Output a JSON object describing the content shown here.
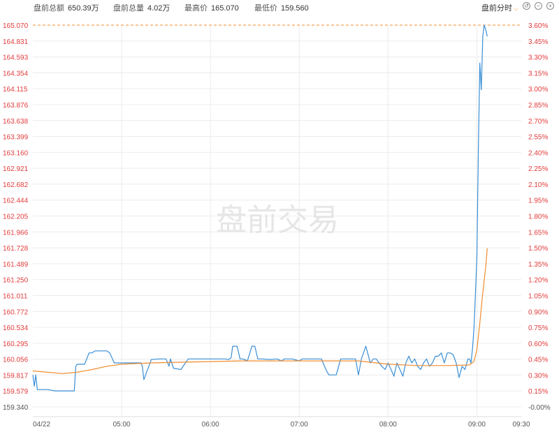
{
  "header": {
    "stats": [
      {
        "label": "盘前总额",
        "value": "650.39万"
      },
      {
        "label": "盘前总量",
        "value": "4.02万"
      },
      {
        "label": "最高价",
        "value": "165.070"
      },
      {
        "label": "最低价",
        "value": "159.560"
      }
    ],
    "mode_label": "盘前分时",
    "tool_icons": [
      "reset-icon",
      "zoom-out-icon",
      "zoom-in-icon"
    ]
  },
  "chart_data": {
    "type": "line",
    "watermark": "盘前交易",
    "date_label": "04/22",
    "x_ticks": [
      "05:00",
      "06:00",
      "07:00",
      "08:00",
      "09:00",
      "09:30"
    ],
    "x_range": [
      "04:00",
      "09:30"
    ],
    "y_left_ticks": [
      "165.070",
      "164.831",
      "164.593",
      "164.354",
      "164.115",
      "163.876",
      "163.638",
      "163.399",
      "163.160",
      "162.921",
      "162.682",
      "162.444",
      "162.205",
      "161.966",
      "161.728",
      "161.489",
      "161.250",
      "161.011",
      "160.772",
      "160.534",
      "160.295",
      "160.056",
      "159.817",
      "159.579",
      "159.340"
    ],
    "y_right_ticks": [
      "3.60%",
      "3.45%",
      "3.30%",
      "3.15%",
      "3.00%",
      "2.85%",
      "2.70%",
      "2.55%",
      "2.40%",
      "2.25%",
      "2.10%",
      "1.95%",
      "1.80%",
      "1.65%",
      "1.50%",
      "1.35%",
      "1.20%",
      "1.05%",
      "0.90%",
      "0.75%",
      "0.60%",
      "0.45%",
      "0.30%",
      "0.15%",
      "-0.00%"
    ],
    "ylim": [
      159.34,
      165.07
    ],
    "reference_high": 165.07,
    "colors": {
      "price": "#3a8fd6",
      "average": "#f08c2e",
      "left_axis": "#e23b3b",
      "right_axis": "#e23b3b",
      "grid": "#ececec",
      "high_line": "#f08c2e"
    },
    "series": [
      {
        "name": "price",
        "x": [
          "04:00",
          "04:01",
          "04:02",
          "04:03",
          "04:05",
          "04:10",
          "04:15",
          "04:20",
          "04:25",
          "04:28",
          "04:29",
          "04:30",
          "04:35",
          "04:38",
          "04:40",
          "04:42",
          "04:45",
          "04:50",
          "04:52",
          "04:55",
          "05:00",
          "05:05",
          "05:10",
          "05:12",
          "05:13",
          "05:14",
          "05:15",
          "05:20",
          "05:25",
          "05:30",
          "05:32",
          "05:33",
          "05:35",
          "05:40",
          "05:45",
          "05:50",
          "05:55",
          "06:00",
          "06:05",
          "06:10",
          "06:12",
          "06:13",
          "06:14",
          "06:15",
          "06:18",
          "06:20",
          "06:22",
          "06:25",
          "06:28",
          "06:30",
          "06:32",
          "06:35",
          "06:40",
          "06:45",
          "06:48",
          "06:50",
          "06:52",
          "06:55",
          "07:00",
          "07:02",
          "07:05",
          "07:08",
          "07:10",
          "07:12",
          "07:15",
          "07:18",
          "07:20",
          "07:22",
          "07:25",
          "07:28",
          "07:30",
          "07:32",
          "07:35",
          "07:38",
          "07:40",
          "07:42",
          "07:45",
          "07:48",
          "07:50",
          "07:52",
          "07:55",
          "07:58",
          "08:00",
          "08:02",
          "08:04",
          "08:06",
          "08:08",
          "08:10",
          "08:12",
          "08:14",
          "08:16",
          "08:18",
          "08:20",
          "08:22",
          "08:24",
          "08:26",
          "08:28",
          "08:30",
          "08:32",
          "08:34",
          "08:36",
          "08:38",
          "08:40",
          "08:42",
          "08:44",
          "08:46",
          "08:48",
          "08:50",
          "08:52",
          "08:54",
          "08:55",
          "08:56",
          "08:57",
          "08:58",
          "08:59",
          "09:00",
          "09:01",
          "09:02",
          "09:03",
          "09:04",
          "09:05",
          "09:06",
          "09:07"
        ],
        "values": [
          159.82,
          159.65,
          159.82,
          159.6,
          159.6,
          159.6,
          159.58,
          159.58,
          159.58,
          159.58,
          159.95,
          159.98,
          159.98,
          160.15,
          160.15,
          160.18,
          160.18,
          160.18,
          160.15,
          160.0,
          160.0,
          160.0,
          160.0,
          160.0,
          160.0,
          159.95,
          159.75,
          160.05,
          160.06,
          160.06,
          159.95,
          160.06,
          159.92,
          159.9,
          160.06,
          160.06,
          160.06,
          160.06,
          160.06,
          160.06,
          160.05,
          160.06,
          160.08,
          160.25,
          160.25,
          160.06,
          160.06,
          160.03,
          160.25,
          160.25,
          160.06,
          160.06,
          160.05,
          160.06,
          160.03,
          160.06,
          160.06,
          160.06,
          160.03,
          160.06,
          160.06,
          160.06,
          160.06,
          160.06,
          160.06,
          159.9,
          159.82,
          159.82,
          159.82,
          160.06,
          160.06,
          160.06,
          160.06,
          160.06,
          159.82,
          160.06,
          160.25,
          160.0,
          160.06,
          160.06,
          159.97,
          159.9,
          160.0,
          159.9,
          159.8,
          160.0,
          159.9,
          159.8,
          160.0,
          160.1,
          160.0,
          160.06,
          159.95,
          159.9,
          160.0,
          160.06,
          159.95,
          160.0,
          160.1,
          160.1,
          160.15,
          160.0,
          160.15,
          160.15,
          160.12,
          160.0,
          159.78,
          159.95,
          159.9,
          160.06,
          160.06,
          160.0,
          160.2,
          160.5,
          161.0,
          161.6,
          163.2,
          164.5,
          164.1,
          164.9,
          165.07,
          165.0,
          164.9
        ]
      },
      {
        "name": "average",
        "x": [
          "04:00",
          "04:10",
          "04:20",
          "04:30",
          "04:40",
          "04:50",
          "05:00",
          "05:20",
          "05:40",
          "06:00",
          "06:20",
          "06:40",
          "07:00",
          "07:20",
          "07:40",
          "08:00",
          "08:20",
          "08:40",
          "08:55",
          "08:58",
          "09:00",
          "09:02",
          "09:04",
          "09:06",
          "09:07"
        ],
        "values": [
          159.88,
          159.86,
          159.84,
          159.86,
          159.9,
          159.95,
          159.98,
          160.0,
          160.01,
          160.02,
          160.03,
          160.03,
          160.03,
          160.03,
          160.03,
          159.98,
          159.96,
          159.96,
          159.97,
          160.02,
          160.2,
          160.6,
          161.05,
          161.45,
          161.72
        ]
      }
    ]
  }
}
